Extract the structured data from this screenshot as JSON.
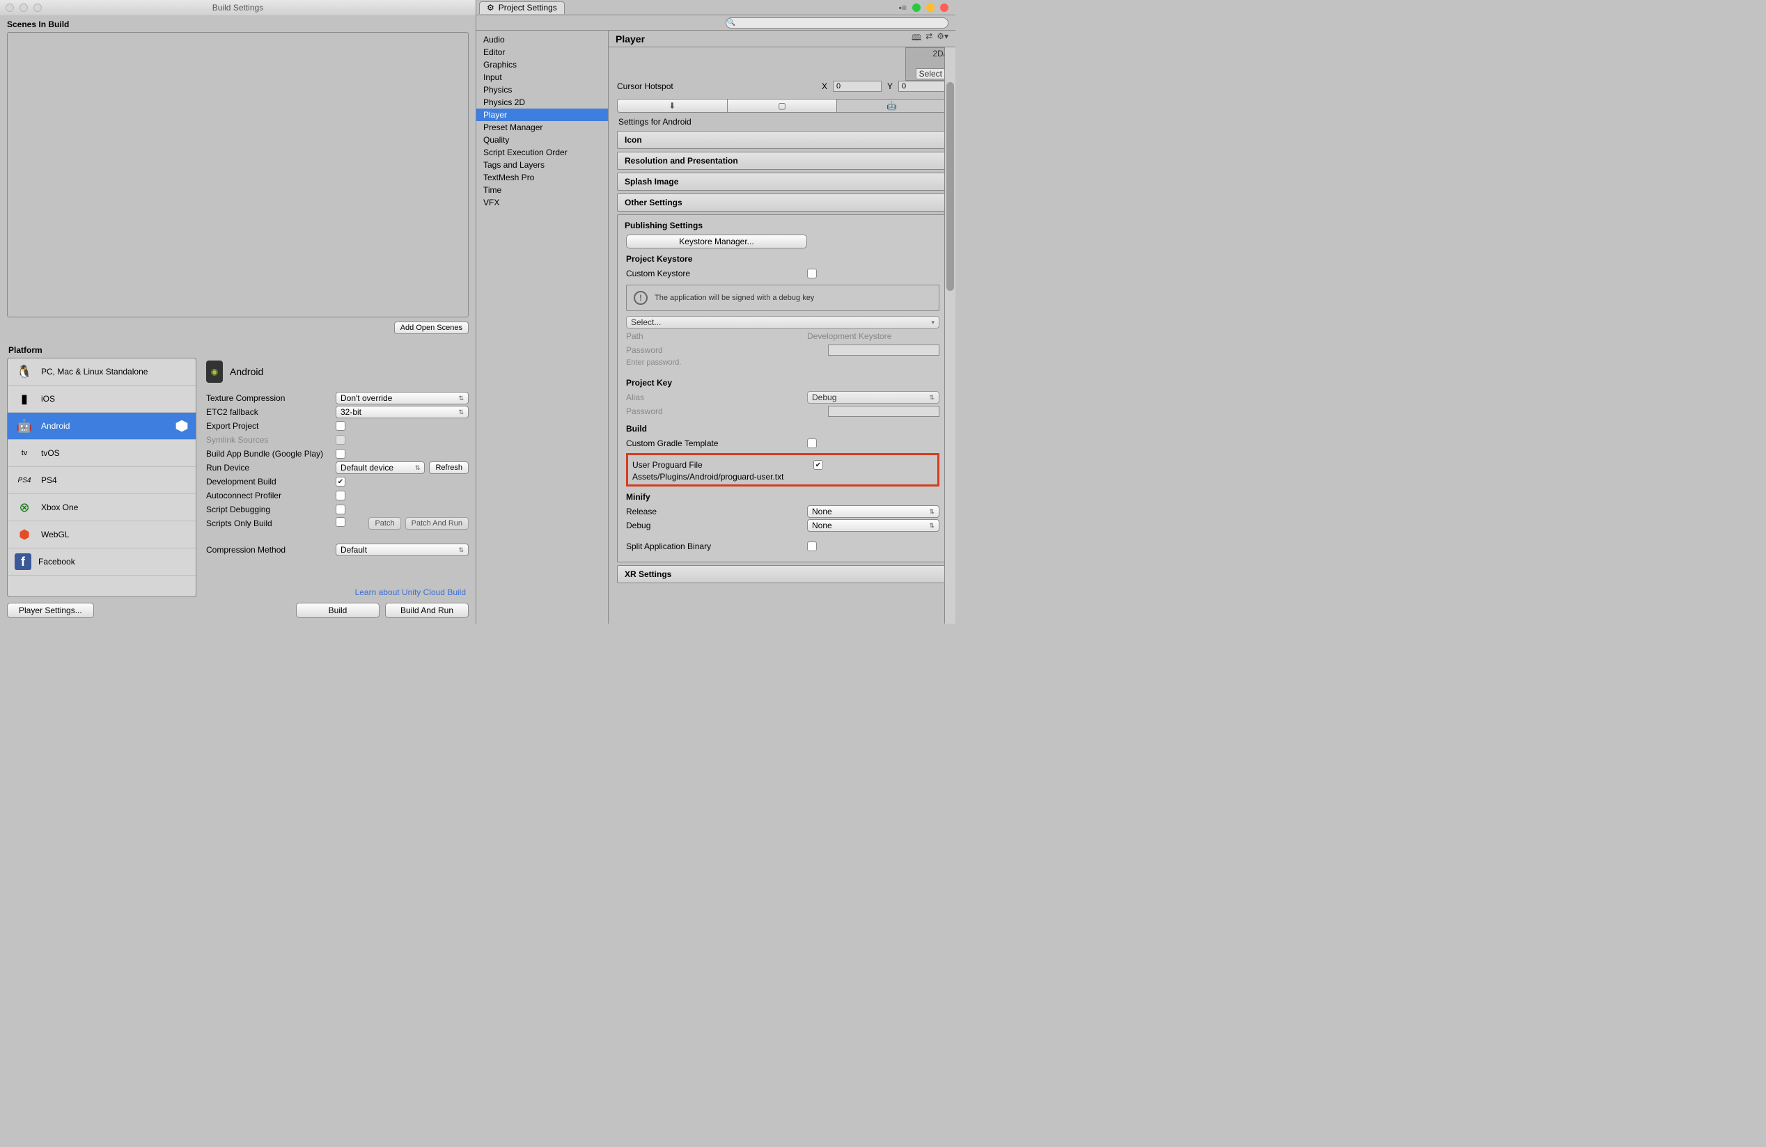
{
  "build": {
    "title": "Build Settings",
    "scenes_label": "Scenes In Build",
    "add_open_scenes": "Add Open Scenes",
    "platform_label": "Platform",
    "platforms": [
      "PC, Mac & Linux Standalone",
      "iOS",
      "Android",
      "tvOS",
      "PS4",
      "Xbox One",
      "WebGL",
      "Facebook"
    ],
    "selected_platform": "Android",
    "android_heading": "Android",
    "options": {
      "texture_compression": {
        "label": "Texture Compression",
        "value": "Don't override"
      },
      "etc2_fallback": {
        "label": "ETC2 fallback",
        "value": "32-bit"
      },
      "export_project": {
        "label": "Export Project",
        "checked": false
      },
      "symlink_sources": {
        "label": "Symlink Sources",
        "checked": false,
        "disabled": true
      },
      "build_app_bundle": {
        "label": "Build App Bundle (Google Play)",
        "checked": false
      },
      "run_device": {
        "label": "Run Device",
        "value": "Default device",
        "refresh": "Refresh"
      },
      "development_build": {
        "label": "Development Build",
        "checked": true
      },
      "autoconnect_profiler": {
        "label": "Autoconnect Profiler",
        "checked": false
      },
      "script_debugging": {
        "label": "Script Debugging",
        "checked": false
      },
      "scripts_only_build": {
        "label": "Scripts Only Build",
        "checked": false,
        "patch": "Patch",
        "patch_run": "Patch And Run"
      },
      "compression_method": {
        "label": "Compression Method",
        "value": "Default"
      }
    },
    "cloud_link": "Learn about Unity Cloud Build",
    "player_settings_btn": "Player Settings...",
    "build_btn": "Build",
    "build_run_btn": "Build And Run"
  },
  "ps": {
    "tab": "Project Settings",
    "categories": [
      "Audio",
      "Editor",
      "Graphics",
      "Input",
      "Physics",
      "Physics 2D",
      "Player",
      "Preset Manager",
      "Quality",
      "Script Execution Order",
      "Tags and Layers",
      "TextMesh Pro",
      "Time",
      "VFX"
    ],
    "selected_category": "Player",
    "title": "Player",
    "icon_chip_2d": "2D/",
    "icon_chip_select": "Select",
    "cursor_hotspot_label": "Cursor Hotspot",
    "cursor_x_label": "X",
    "cursor_x": "0",
    "cursor_y_label": "Y",
    "cursor_y": "0",
    "settings_for": "Settings for Android",
    "sections": {
      "icon": "Icon",
      "resolution": "Resolution and Presentation",
      "splash": "Splash Image",
      "other": "Other Settings",
      "xr": "XR Settings"
    },
    "publishing": {
      "header": "Publishing Settings",
      "keystore_manager_btn": "Keystore Manager...",
      "project_keystore": "Project Keystore",
      "custom_keystore_label": "Custom Keystore",
      "info_text": "The application will be signed with a debug key",
      "select_label": "Select...",
      "path_label": "Path",
      "path_value": "Development Keystore",
      "password_label": "Password",
      "password_hint": "Enter password.",
      "project_key": "Project Key",
      "alias_label": "Alias",
      "alias_value": "Debug",
      "pk_password_label": "Password",
      "build_hdr": "Build",
      "custom_gradle_label": "Custom Gradle Template",
      "user_proguard_label": "User Proguard File",
      "user_proguard_path": "Assets/Plugins/Android/proguard-user.txt",
      "minify_hdr": "Minify",
      "release_label": "Release",
      "release_value": "None",
      "debug_label": "Debug",
      "debug_value": "None",
      "split_binary_label": "Split Application Binary"
    }
  }
}
